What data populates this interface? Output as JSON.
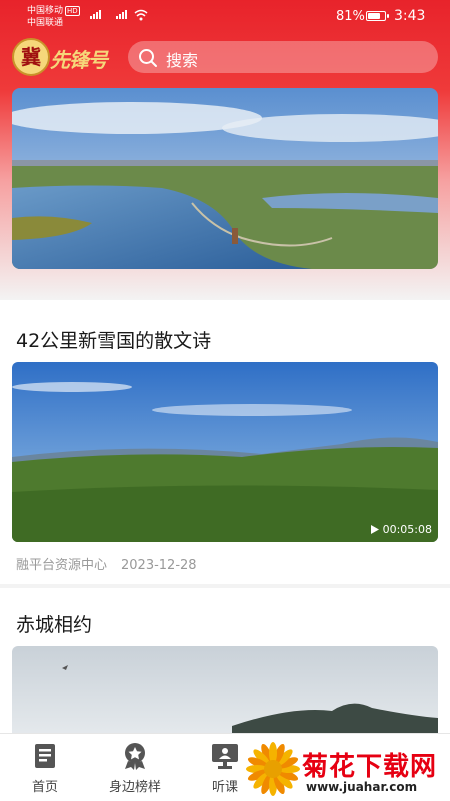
{
  "status_bar": {
    "carrier_1": "中国移动",
    "hd_badge": "HD",
    "carrier_2": "中国联通",
    "battery_percent": "81%",
    "battery_level": 0.81,
    "time": "3:43"
  },
  "header": {
    "logo_text": "冀先锋号",
    "search_placeholder": "搜索"
  },
  "banner": {
    "image_icon": "aerial-lake-wetland-image"
  },
  "feed": [
    {
      "title": "42公里新雪国的散文诗",
      "duration": "00:05:08",
      "source": "融平台资源中心",
      "date": "2023-12-28",
      "thumbnail_icon": "grassland-video-thumbnail"
    },
    {
      "title": "赤城相约",
      "thumbnail_icon": "misty-mountain-thumbnail"
    }
  ],
  "tabs": [
    {
      "label": "首页",
      "icon": "book-icon"
    },
    {
      "label": "身边榜样",
      "icon": "medal-icon"
    },
    {
      "label": "听课",
      "icon": "lecture-screen-icon"
    }
  ],
  "watermark": {
    "title": "菊花下载网",
    "url": "www.juahar.com",
    "icon": "chrysanthemum-icon"
  },
  "colors": {
    "brand_red": "#e8232b",
    "gold": "#f6d77a"
  }
}
